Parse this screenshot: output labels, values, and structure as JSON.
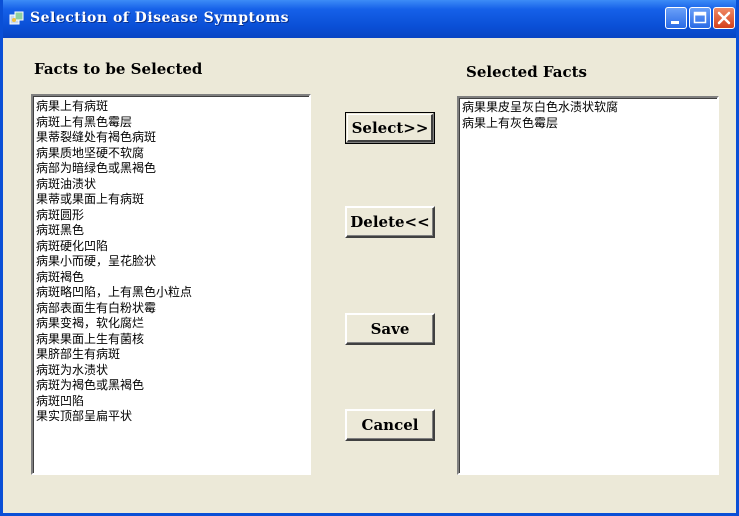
{
  "window": {
    "title": "Selection of Disease Symptoms"
  },
  "labels": {
    "facts_to_select": "Facts to be Selected",
    "selected_facts": "Selected Facts"
  },
  "available_facts": [
    "病果上有病斑",
    "病斑上有黑色霉层",
    "果蒂裂缝处有褐色病斑",
    "病果质地坚硬不软腐",
    "病部为暗绿色或黑褐色",
    "病斑油渍状",
    "果蒂或果面上有病斑",
    "病斑圆形",
    "病斑黑色",
    "病斑硬化凹陷",
    "病果小而硬，呈花脸状",
    "病斑褐色",
    "病斑略凹陷，上有黑色小粒点",
    "病部表面生有白粉状霉",
    "病果变褐，软化腐烂",
    "病果果面上生有菌核",
    "果脐部生有病斑",
    "病斑为水渍状",
    "病斑为褐色或黑褐色",
    "病斑凹陷",
    "果实顶部呈扁平状"
  ],
  "selected_facts": [
    "病果果皮呈灰白色水渍状软腐",
    "病果上有灰色霉层"
  ],
  "buttons": {
    "select": "Select>>",
    "delete": "Delete<<",
    "save": "Save",
    "cancel": "Cancel"
  },
  "icons": {
    "app": "app-icon",
    "minimize": "minimize-icon",
    "maximize": "maximize-icon",
    "close": "close-icon"
  },
  "colors": {
    "titlebar": "#0a4fd6",
    "window_bg": "#ece9d8",
    "close_button": "#d4401c"
  }
}
